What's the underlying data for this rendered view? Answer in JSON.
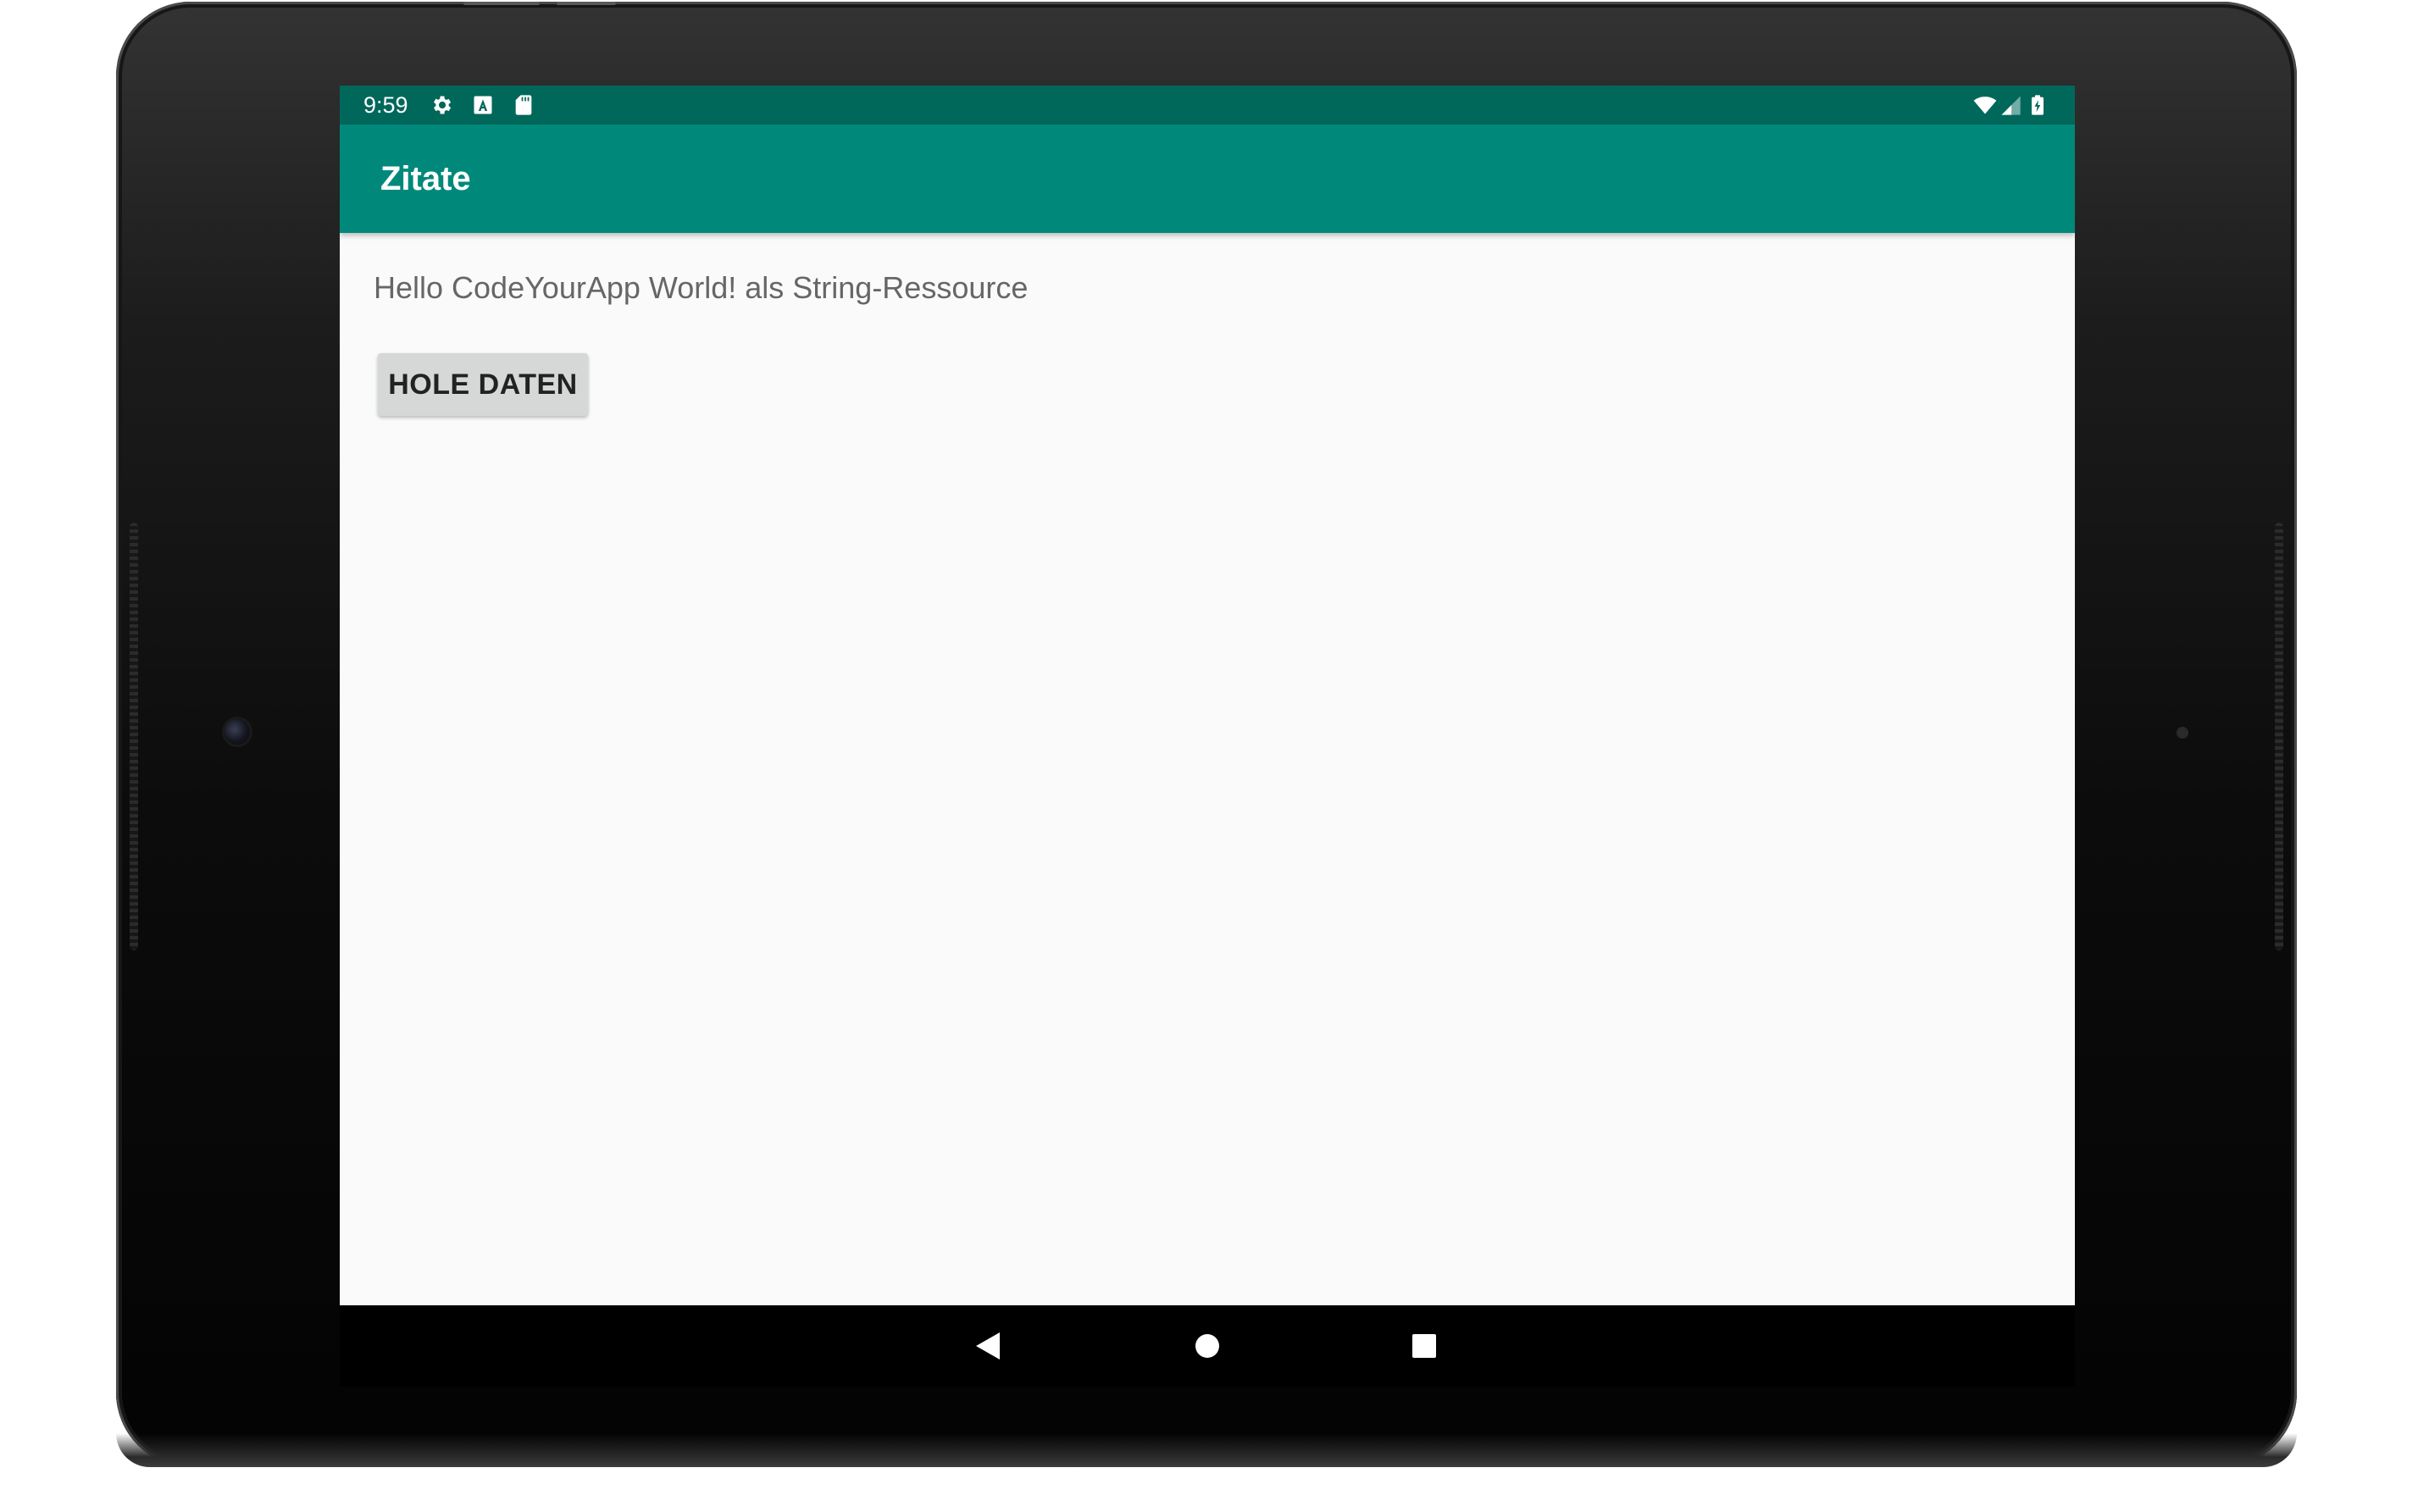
{
  "status_bar": {
    "time": "9:59",
    "left_icons": [
      "settings-gear-icon",
      "text-a-icon",
      "sd-card-icon"
    ],
    "right_icons": [
      "wifi-icon",
      "cell-signal-icon",
      "battery-charging-icon"
    ]
  },
  "app_bar": {
    "title": "Zitate"
  },
  "content": {
    "hello_text": "Hello CodeYourApp World! als String-Ressource",
    "button_label": "HOLE DATEN"
  },
  "nav_bar": {
    "buttons": [
      "back-icon",
      "home-icon",
      "recents-icon"
    ]
  },
  "colors": {
    "status_bar": "#00675b",
    "app_bar": "#00897b",
    "screen_background": "#fafafa",
    "button_background": "#d6d7d7",
    "device_body": "#111111"
  }
}
